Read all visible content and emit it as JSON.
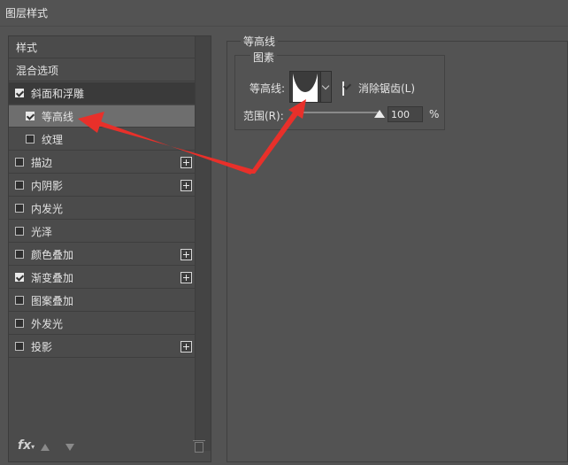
{
  "window": {
    "title": "图层样式"
  },
  "left_panel": {
    "header_styles": "样式",
    "header_blend": "混合选项",
    "items": [
      {
        "label": "斜面和浮雕",
        "checked": true,
        "plus": false,
        "state": "selected"
      },
      {
        "label": "等高线",
        "checked": true,
        "plus": false,
        "state": "subselected",
        "sub": true
      },
      {
        "label": "纹理",
        "checked": false,
        "plus": false,
        "state": "normal",
        "sub": true
      },
      {
        "label": "描边",
        "checked": false,
        "plus": true
      },
      {
        "label": "内阴影",
        "checked": false,
        "plus": true
      },
      {
        "label": "内发光",
        "checked": false,
        "plus": false
      },
      {
        "label": "光泽",
        "checked": false,
        "plus": false
      },
      {
        "label": "颜色叠加",
        "checked": false,
        "plus": true
      },
      {
        "label": "渐变叠加",
        "checked": true,
        "plus": true
      },
      {
        "label": "图案叠加",
        "checked": false,
        "plus": false
      },
      {
        "label": "外发光",
        "checked": false,
        "plus": false
      },
      {
        "label": "投影",
        "checked": false,
        "plus": true
      }
    ],
    "footer": {
      "fx_label": "fx"
    }
  },
  "contour_panel": {
    "section_title": "等高线",
    "group_title": "图素",
    "contour_label": "等高线:",
    "anti_alias": {
      "label": "消除锯齿(L)",
      "checked": true
    },
    "range_label": "范围(R):",
    "range_value": "100",
    "range_unit": "%",
    "range_fraction": 1.0
  },
  "colors": {
    "background": "#535353",
    "arrow": "#e8302a"
  },
  "icons": [
    "check-icon",
    "plus-icon",
    "fx-icon",
    "arrow-up-icon",
    "arrow-down-icon",
    "trash-icon",
    "chevron-down-icon",
    "contour-curve-icon",
    "slider-thumb-icon",
    "annotation-arrow-icon"
  ]
}
